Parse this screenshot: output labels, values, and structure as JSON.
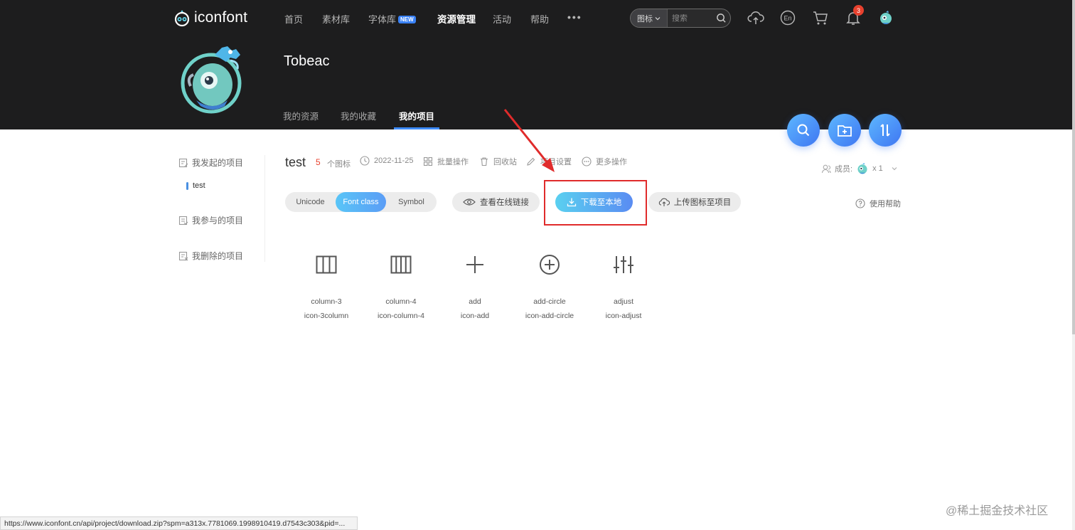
{
  "nav": {
    "logo_text": "iconfont",
    "items": [
      {
        "label": "首页"
      },
      {
        "label": "素材库"
      },
      {
        "label": "字体库",
        "badge": "NEW"
      },
      {
        "label": "资源管理"
      },
      {
        "label": "活动"
      },
      {
        "label": "帮助"
      }
    ],
    "more": "•••",
    "search": {
      "type_label": "图标",
      "placeholder": "搜索"
    },
    "notification_count": "3"
  },
  "profile": {
    "username": "Tobeac",
    "tabs": [
      {
        "label": "我的资源"
      },
      {
        "label": "我的收藏"
      },
      {
        "label": "我的项目"
      }
    ]
  },
  "sidebar": {
    "items": [
      {
        "label": "我发起的项目"
      },
      {
        "label": "我参与的项目"
      },
      {
        "label": "我删除的项目"
      }
    ],
    "project": "test"
  },
  "project": {
    "name": "test",
    "count": "5",
    "count_label": "个图标",
    "date": "2022-11-25",
    "actions": [
      {
        "label": "批量操作"
      },
      {
        "label": "回收站"
      },
      {
        "label": "项目设置"
      },
      {
        "label": "更多操作"
      }
    ],
    "members_label": "成员:",
    "members_count": "x 1",
    "help_label": "使用帮助"
  },
  "toolbar": {
    "modes": [
      {
        "label": "Unicode"
      },
      {
        "label": "Font class"
      },
      {
        "label": "Symbol"
      }
    ],
    "view_link": "查看在线链接",
    "download": "下载至本地",
    "upload": "上传图标至项目"
  },
  "icons": [
    {
      "name": "column-3",
      "class": "icon-3column"
    },
    {
      "name": "column-4",
      "class": "icon-column-4"
    },
    {
      "name": "add",
      "class": "icon-add"
    },
    {
      "name": "add-circle",
      "class": "icon-add-circle"
    },
    {
      "name": "adjust",
      "class": "icon-adjust"
    }
  ],
  "status_url": "https://www.iconfont.cn/api/project/download.zip?spm=a313x.7781069.1998910419.d7543c303&pid=...",
  "watermark": "@稀土掘金技术社区",
  "colors": {
    "header_bg": "#1d1d1e",
    "accent": "#3d8af7",
    "count_red": "#e8412e",
    "highlight_box": "#e02b2b"
  }
}
